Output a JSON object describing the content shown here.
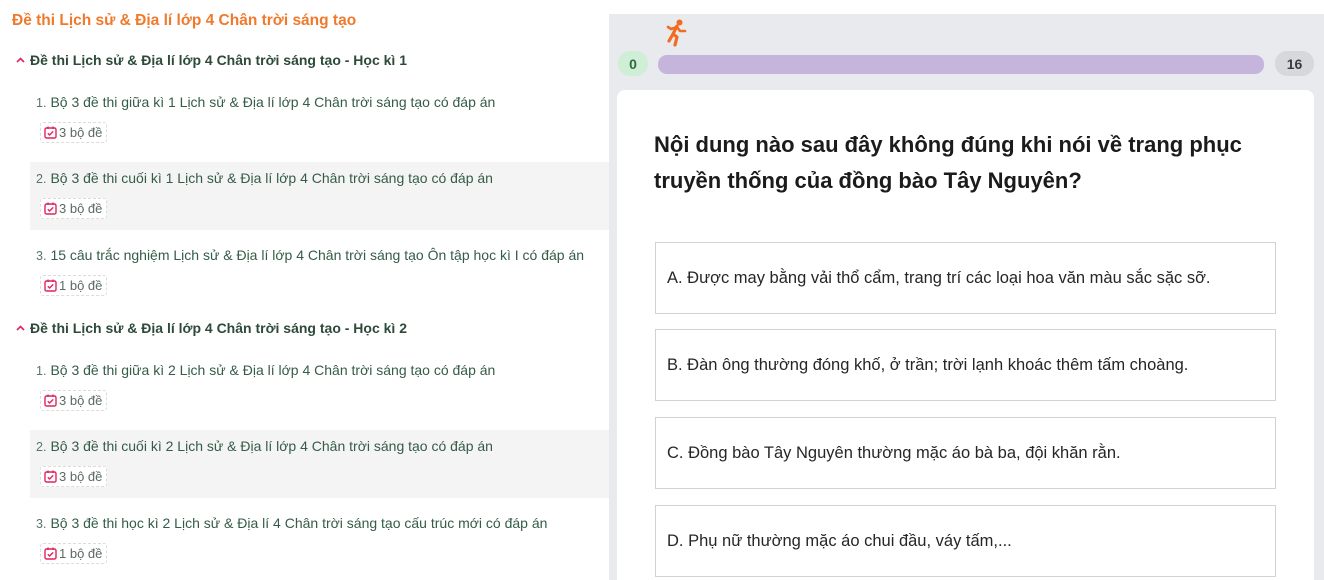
{
  "page_title": "Đề thi Lịch sử & Địa lí lớp 4 Chân trời sáng tạo",
  "sections": [
    {
      "title": "Đề thi Lịch sử & Địa lí lớp 4 Chân trời sáng tạo - Học kì 1",
      "items": [
        {
          "num": "1.",
          "title": "Bộ 3 đề thi giữa kì 1 Lịch sử & Địa lí lớp 4 Chân trời sáng tạo có đáp án",
          "badge": "3 bộ đề"
        },
        {
          "num": "2.",
          "title": "Bộ 3 đề thi cuối kì 1 Lịch sử & Địa lí lớp 4 Chân trời sáng tạo có đáp án",
          "badge": "3 bộ đề"
        },
        {
          "num": "3.",
          "title": "15 câu trắc nghiệm Lịch sử & Địa lí lớp 4 Chân trời sáng tạo Ôn tập học kì I có đáp án",
          "badge": "1 bộ đề"
        }
      ]
    },
    {
      "title": "Đề thi Lịch sử & Địa lí lớp 4 Chân trời sáng tạo - Học kì 2",
      "items": [
        {
          "num": "1.",
          "title": "Bộ 3 đề thi giữa kì 2 Lịch sử & Địa lí lớp 4 Chân trời sáng tạo có đáp án",
          "badge": "3 bộ đề"
        },
        {
          "num": "2.",
          "title": "Bộ 3 đề thi cuối kì 2 Lịch sử & Địa lí lớp 4 Chân trời sáng tạo có đáp án",
          "badge": "3 bộ đề"
        },
        {
          "num": "3.",
          "title": "Bộ 3 đề thi học kì 2 Lịch sử & Địa lí 4 Chân trời sáng tạo cấu trúc mới có đáp án",
          "badge": "1 bộ đề"
        }
      ]
    }
  ],
  "quiz": {
    "score_correct": "0",
    "total": "16",
    "progress": 0,
    "question": "Nội dung nào sau đây không đúng khi nói về trang phục truyền thống của đồng bào Tây Nguyên?",
    "options": [
      "A. Được may bằng vải thổ cẩm, trang trí các loại hoa văn màu sắc sặc sỡ.",
      "B. Đàn ông thường đóng khố, ở trần; trời lạnh khoác thêm tấm choàng.",
      "C. Đồng bào Tây Nguyên thường mặc áo bà ba, đội khăn rằn.",
      "D. Phụ nữ thường mặc áo chui đầu, váy tấm,..."
    ]
  },
  "colors": {
    "title_orange": "#f07a2c",
    "progress_track": "#c5b4dc",
    "correct_badge": "#cfeed6",
    "calendar_red": "#e0245e"
  },
  "icons": {
    "section_toggle": "chevron-up-icon",
    "badge": "calendar-check-icon",
    "progress_marker": "running-person-icon"
  }
}
